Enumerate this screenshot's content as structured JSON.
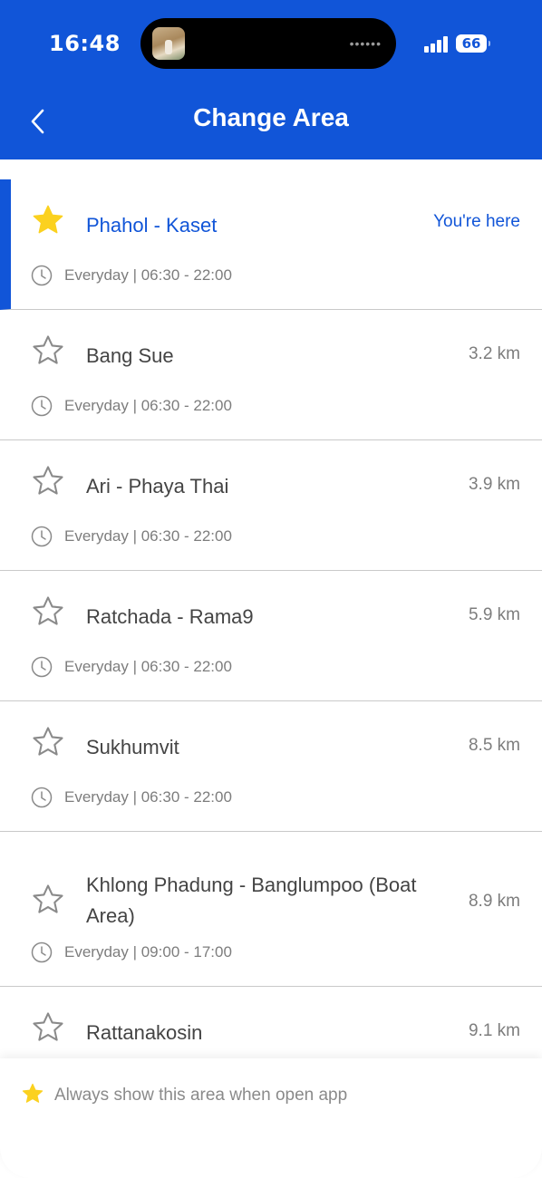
{
  "status_bar": {
    "time": "16:48",
    "dots": "••••••",
    "battery": "66"
  },
  "header": {
    "title": "Change Area"
  },
  "areas": [
    {
      "name": "Phahol - Kaset",
      "hours": "Everyday | 06:30 - 22:00",
      "badge": "You're here",
      "favorite": true
    },
    {
      "name": "Bang Sue",
      "hours": "Everyday | 06:30 - 22:00",
      "distance": "3.2 km",
      "favorite": false
    },
    {
      "name": "Ari - Phaya Thai",
      "hours": "Everyday | 06:30 - 22:00",
      "distance": "3.9 km",
      "favorite": false
    },
    {
      "name": "Ratchada - Rama9",
      "hours": "Everyday | 06:30 - 22:00",
      "distance": "5.9 km",
      "favorite": false
    },
    {
      "name": "Sukhumvit",
      "hours": "Everyday | 06:30 - 22:00",
      "distance": "8.5 km",
      "favorite": false
    },
    {
      "name": "Khlong Phadung - Banglumpoo (Boat Area)",
      "hours": "Everyday | 09:00 - 17:00",
      "distance": "8.9 km",
      "favorite": false
    },
    {
      "name": "Rattanakosin",
      "distance": "9.1 km",
      "favorite": false
    }
  ],
  "footer": {
    "hint": "Always show this area when open app"
  },
  "colors": {
    "primary": "#1155d8",
    "star_active": "#fbd11f",
    "star_inactive": "#8a8a8a"
  },
  "icons": {
    "back": "chevron-left-icon",
    "star": "star-icon",
    "clock": "clock-icon"
  }
}
